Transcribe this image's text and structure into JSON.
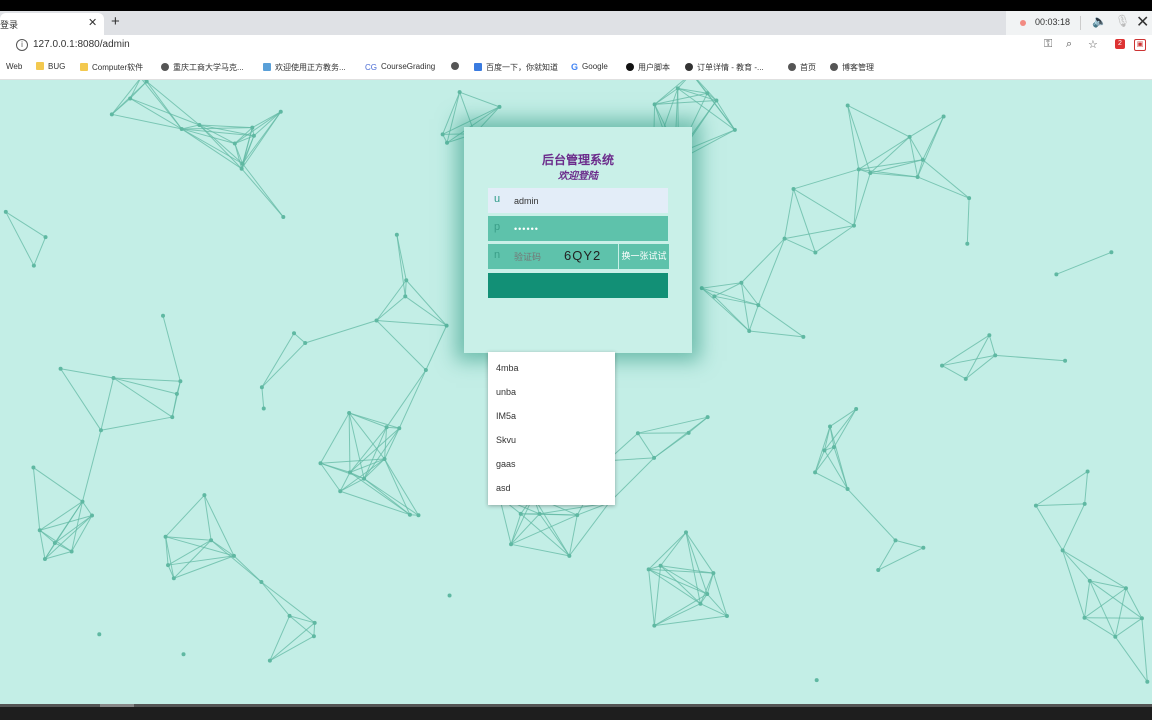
{
  "browser": {
    "tab_title": "登录",
    "tab_close": "✕",
    "new_tab": "+",
    "url": "127.0.0.1:8080/admin",
    "recording_time": "00:03:18",
    "extension_badge": "2"
  },
  "bookmarks": [
    {
      "label": "Web",
      "icon": "none"
    },
    {
      "label": "BUG",
      "icon": "folder-icon"
    },
    {
      "label": "Computer软件",
      "icon": "folder-icon"
    },
    {
      "label": "重庆工商大学马克...",
      "icon": "globe-icon"
    },
    {
      "label": "欢迎使用正方教务...",
      "icon": "cube-icon"
    },
    {
      "label": "CourseGrading",
      "icon": "cg-icon"
    },
    {
      "label": "",
      "icon": "globe-icon"
    },
    {
      "label": "百度一下，你就知道",
      "icon": "house-icon"
    },
    {
      "label": "Google",
      "icon": "google-icon"
    },
    {
      "label": "用户脚本",
      "icon": "userscript-icon"
    },
    {
      "label": "订单详情 - 教育 -...",
      "icon": "apple-icon"
    },
    {
      "label": "首页",
      "icon": "globe-icon"
    },
    {
      "label": "博客管理",
      "icon": "globe-icon"
    }
  ],
  "login": {
    "title": "后台管理系统",
    "subtitle": "欢迎登陆",
    "username_icon": "u",
    "username_value": "admin",
    "password_icon": "p",
    "password_value": "••••••",
    "code_icon": "n",
    "code_placeholder": "验证码",
    "captcha_text": "6QY2",
    "captcha_refresh": "换一张试试"
  },
  "autocomplete": [
    "4mba",
    "unba",
    "IM5a",
    "Skvu",
    "gaas",
    "asd"
  ],
  "colors": {
    "background": "#c3eee6",
    "title": "#6b2b8b",
    "input_active": "#5ec2ab",
    "button": "#129076"
  }
}
